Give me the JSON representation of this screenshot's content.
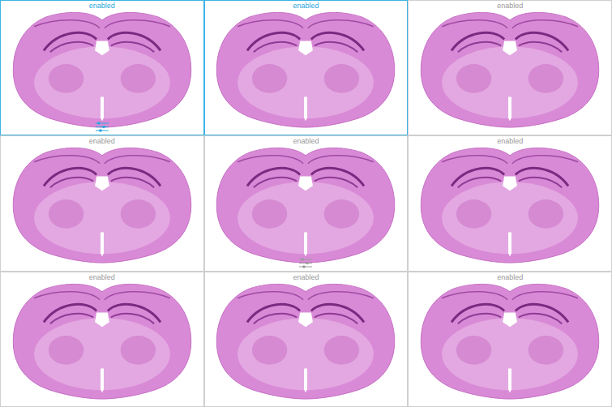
{
  "cells": [
    {
      "label": "enabled",
      "selected": true,
      "adjusted": true
    },
    {
      "label": "enabled",
      "selected": true,
      "adjusted": false
    },
    {
      "label": "enabled",
      "selected": false,
      "adjusted": false
    },
    {
      "label": "enabled",
      "selected": false,
      "adjusted": false
    },
    {
      "label": "enabled",
      "selected": false,
      "adjusted": true
    },
    {
      "label": "enabled",
      "selected": false,
      "adjusted": false
    },
    {
      "label": "enabled",
      "selected": false,
      "adjusted": false
    },
    {
      "label": "enabled",
      "selected": false,
      "adjusted": false
    },
    {
      "label": "enabled",
      "selected": false,
      "adjusted": false
    }
  ]
}
